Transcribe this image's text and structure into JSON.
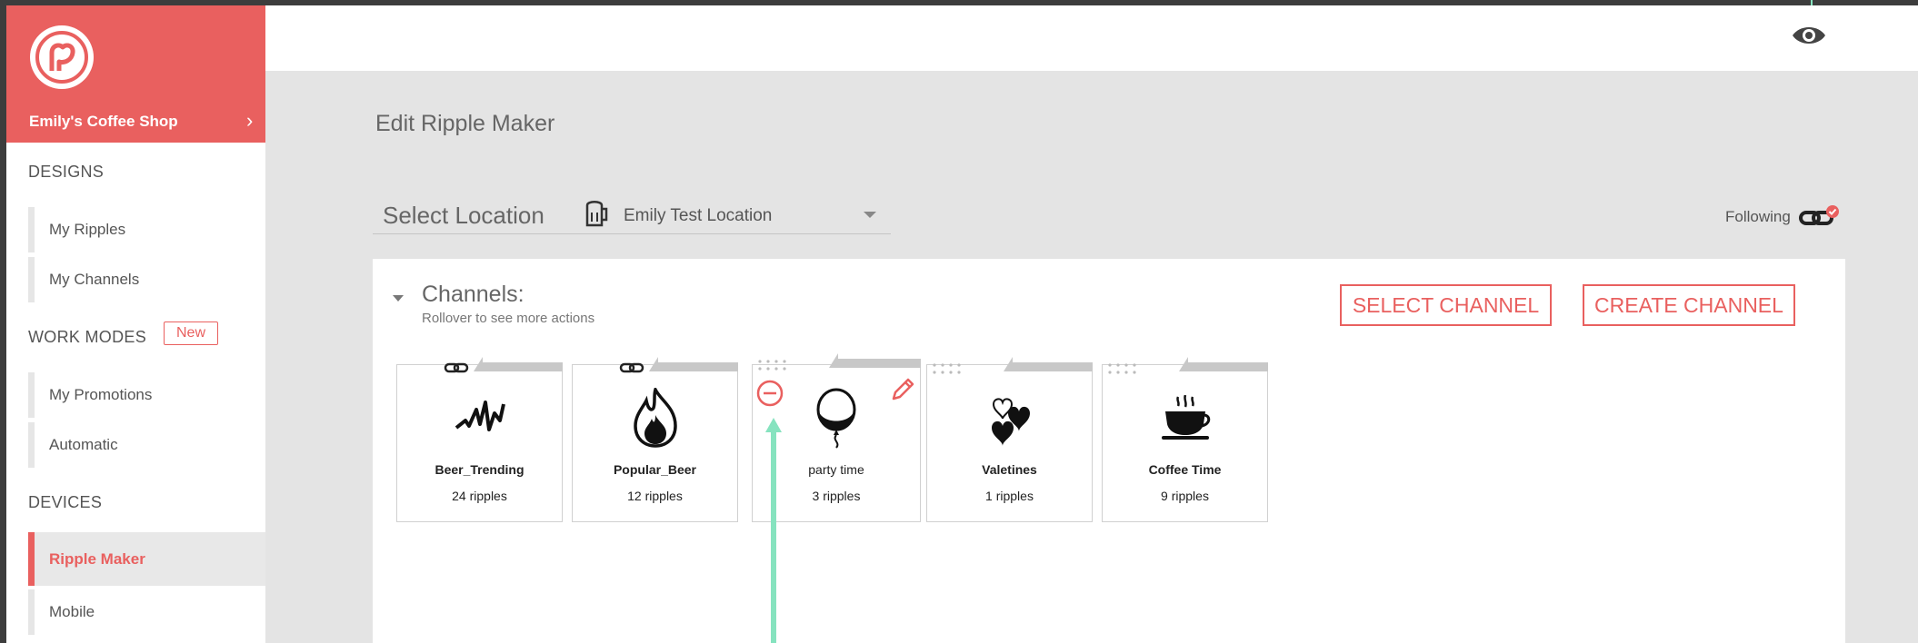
{
  "sidebar": {
    "shop_name": "Emily's Coffee Shop",
    "sections": {
      "designs": "DESIGNS",
      "work_modes": "WORK MODES",
      "new_badge": "New",
      "devices": "DEVICES"
    },
    "items": {
      "my_ripples": "My Ripples",
      "my_channels": "My Channels",
      "my_promotions": "My Promotions",
      "automatic": "Automatic",
      "ripple_maker": "Ripple Maker",
      "mobile": "Mobile"
    },
    "active_item": "Ripple Maker"
  },
  "header": {
    "page_title": "Edit Ripple Maker"
  },
  "location": {
    "label": "Select Location",
    "value": "Emily Test Location"
  },
  "following": {
    "label": "Following"
  },
  "channels": {
    "title": "Channels:",
    "subtitle": "Rollover to see more actions",
    "select_button": "SELECT CHANNEL",
    "create_button": "CREATE CHANNEL",
    "cards": [
      {
        "name": "Beer_Trending",
        "count": "24 ripples",
        "icon": "squiggle-icon"
      },
      {
        "name": "Popular_Beer",
        "count": "12 ripples",
        "icon": "flame-icon"
      },
      {
        "name": "party time",
        "count": "3 ripples",
        "icon": "balloon-icon"
      },
      {
        "name": "Valetines",
        "count": "1 ripples",
        "icon": "hearts-icon"
      },
      {
        "name": "Coffee Time",
        "count": "9 ripples",
        "icon": "coffee-cup-icon"
      }
    ]
  },
  "colors": {
    "accent": "#e9605f",
    "marker": "#86e3bf",
    "background": "#e4e4e4"
  }
}
